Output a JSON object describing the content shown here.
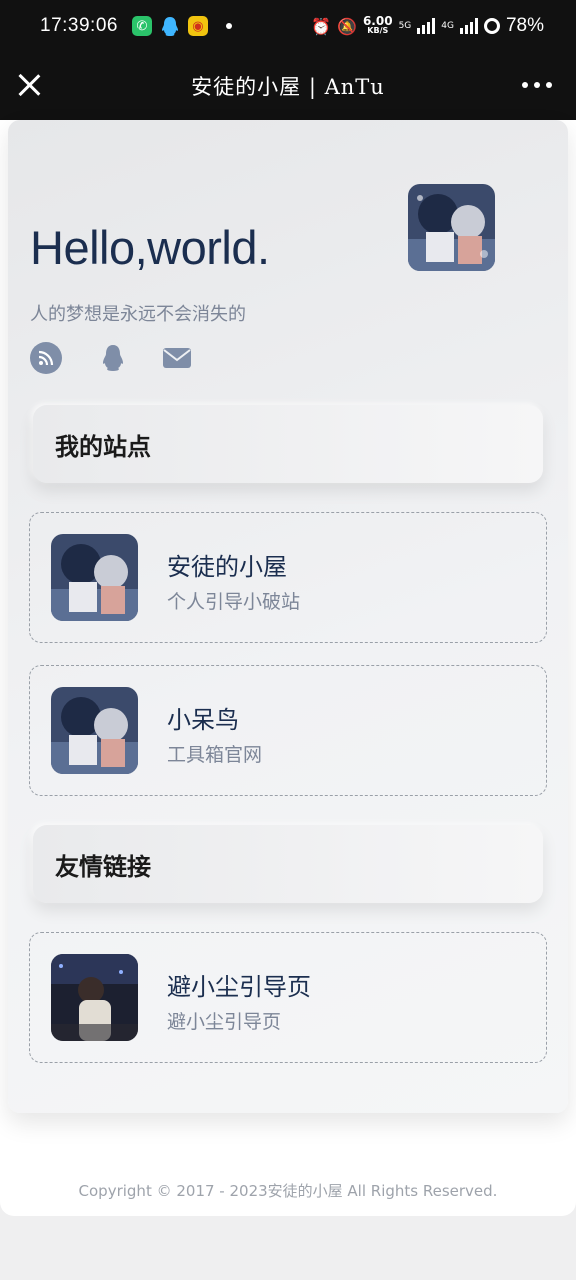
{
  "status_bar": {
    "time": "17:39:06",
    "speed_value": "6.00",
    "speed_unit": "KB/S",
    "net1": "5G",
    "net2": "4G",
    "battery": "78%"
  },
  "nav": {
    "title": "安徒的小屋 | AnTu"
  },
  "profile": {
    "greeting": "Hello,world.",
    "motto": "人的梦想是永远不会消失的"
  },
  "sections": {
    "my_sites": "我的站点",
    "friend_links": "友情链接"
  },
  "sites": [
    {
      "name": "安徒的小屋",
      "desc": "个人引导小破站"
    },
    {
      "name": "小呆鸟",
      "desc": "工具箱官网"
    }
  ],
  "friends": [
    {
      "name": "避小尘引导页",
      "desc": "避小尘引导页"
    }
  ],
  "footer": {
    "copyright": "Copyright © 2017 - 2023安徒的小屋 All Rights Reserved."
  },
  "colors": {
    "title": "#1b2e4f",
    "muted": "#7d8698",
    "icon": "#7f8ea8"
  }
}
